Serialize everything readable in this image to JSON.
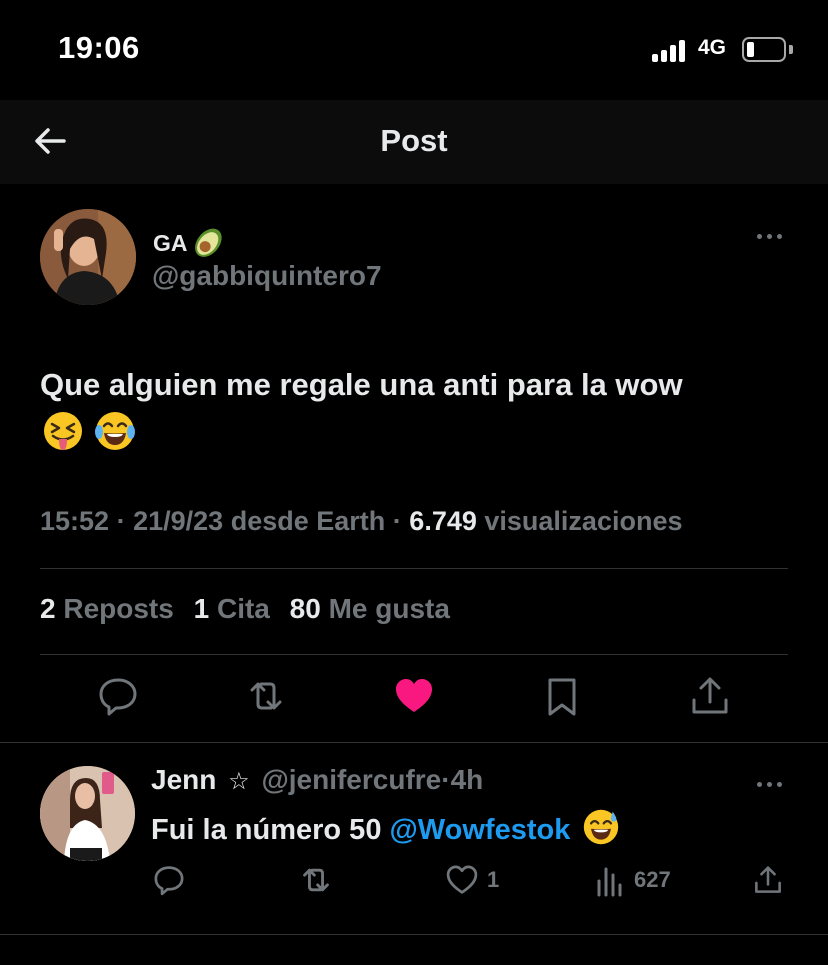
{
  "status_bar": {
    "time": "19:06",
    "network": "4G"
  },
  "nav": {
    "title": "Post"
  },
  "post": {
    "display_name": "GA",
    "handle": "@gabbiquintero7",
    "text": "Que alguien me regale una anti para la wow",
    "time": "15:52",
    "date": "21/9/23",
    "source": "desde Earth",
    "views_count": "6.749",
    "views_label": "visualizaciones",
    "separator": "·",
    "reposts_count": "2",
    "reposts_label": "Reposts",
    "quotes_count": "1",
    "quotes_label": "Cita",
    "likes_count": "80",
    "likes_label": "Me gusta",
    "liked": true
  },
  "reply": {
    "name": "Jenn",
    "star": "☆",
    "handle": "@jenifercufre",
    "age": "4h",
    "text": "Fui la número 50",
    "mention": "@Wowfestok",
    "likes_count": "1",
    "views_count": "627"
  },
  "colors": {
    "background": "#000000",
    "text": "#e7e9ea",
    "muted": "#71767b",
    "accent": "#1d9bf0",
    "like": "#f91880",
    "divider": "#2f3336"
  },
  "icons": {
    "back": "arrow-left-icon",
    "more": "more-horizontal-icon",
    "reply": "comment-icon",
    "repost": "repost-icon",
    "like": "heart-icon",
    "bookmark": "bookmark-icon",
    "share": "share-icon",
    "views": "bar-chart-icon"
  }
}
